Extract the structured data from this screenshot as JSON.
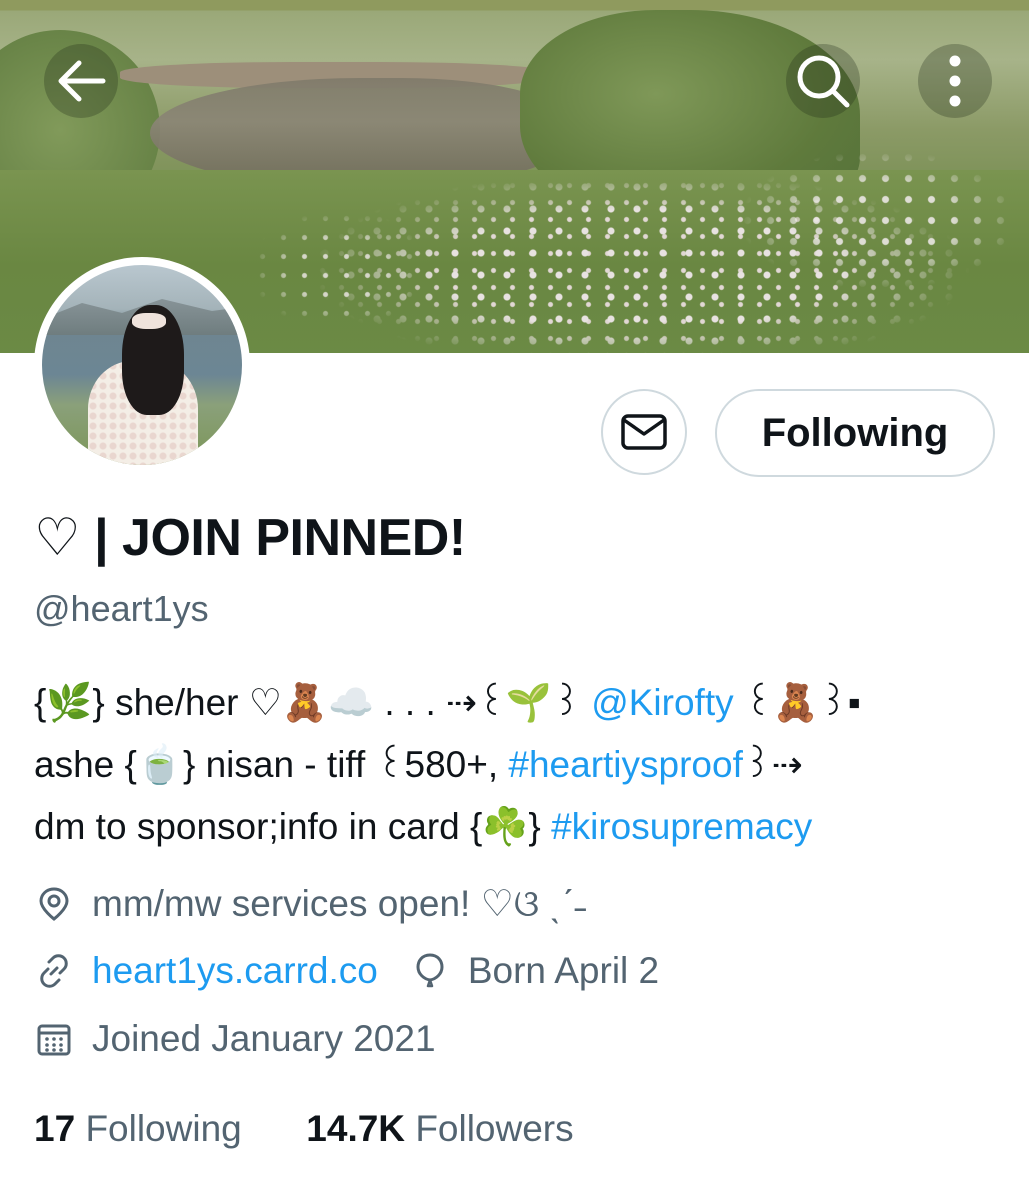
{
  "header": {
    "back_icon": "arrow-left-icon",
    "search_icon": "search-icon",
    "more_icon": "more-vertical-icon"
  },
  "profile": {
    "display_name": "♡ | JOIN PINNED!",
    "handle": "@heart1ys",
    "message_icon": "envelope-icon",
    "follow_button_label": "Following",
    "bio": {
      "line1_text": "{🌿} she/her ♡🧸☁️ . . . ⇢꒰🌱꒱",
      "line1_link": "@Kirofty",
      "line1_tail": "꒰🧸꒱▪",
      "line2_text": "ashe {🍵} nisan - tiff ꒰580+,",
      "line2_link": "#heartiysproof",
      "line2_tail": "꒱⇢",
      "line3_text": "dm to sponsor;info in card {☘️}",
      "line3_link": "#kirosupremacy"
    },
    "location": "mm/mw services open! ♡ଓ ˎˊ˗",
    "website": "heart1ys.carrd.co",
    "birthday": "Born April 2",
    "joined": "Joined January 2021",
    "following_count": "17",
    "following_label": "Following",
    "followers_count": "14.7K",
    "followers_label": "Followers",
    "accent_color": "#1d9bf0",
    "secondary_text_color": "#536471"
  }
}
